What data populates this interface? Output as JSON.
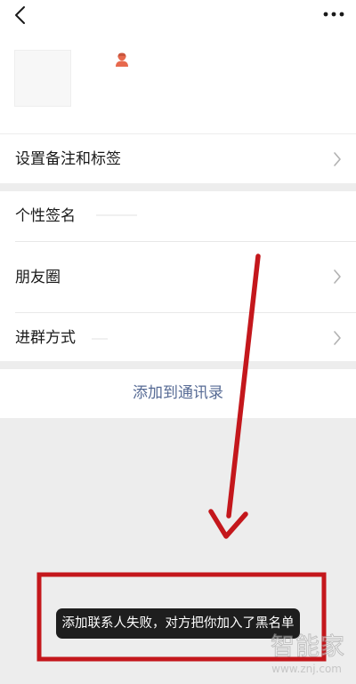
{
  "profile": {
    "avatar_icon": "avatar-placeholder",
    "gender_icon": "female-person-icon",
    "gender_color": "#e7694d"
  },
  "menu": {
    "remark_label": "设置备注和标签",
    "signature_label": "个性签名",
    "moments_label": "朋友圈",
    "group_method_label": "进群方式"
  },
  "actions": {
    "add_contact_label": "添加到通讯录"
  },
  "toast": {
    "message": "添加联系人失败，对方把你加入了黑名单"
  },
  "watermark": {
    "main": "智能家",
    "sub": "www.znj.com"
  },
  "colors": {
    "link": "#576b95",
    "annotation": "#c4171c",
    "background": "#ededed"
  }
}
